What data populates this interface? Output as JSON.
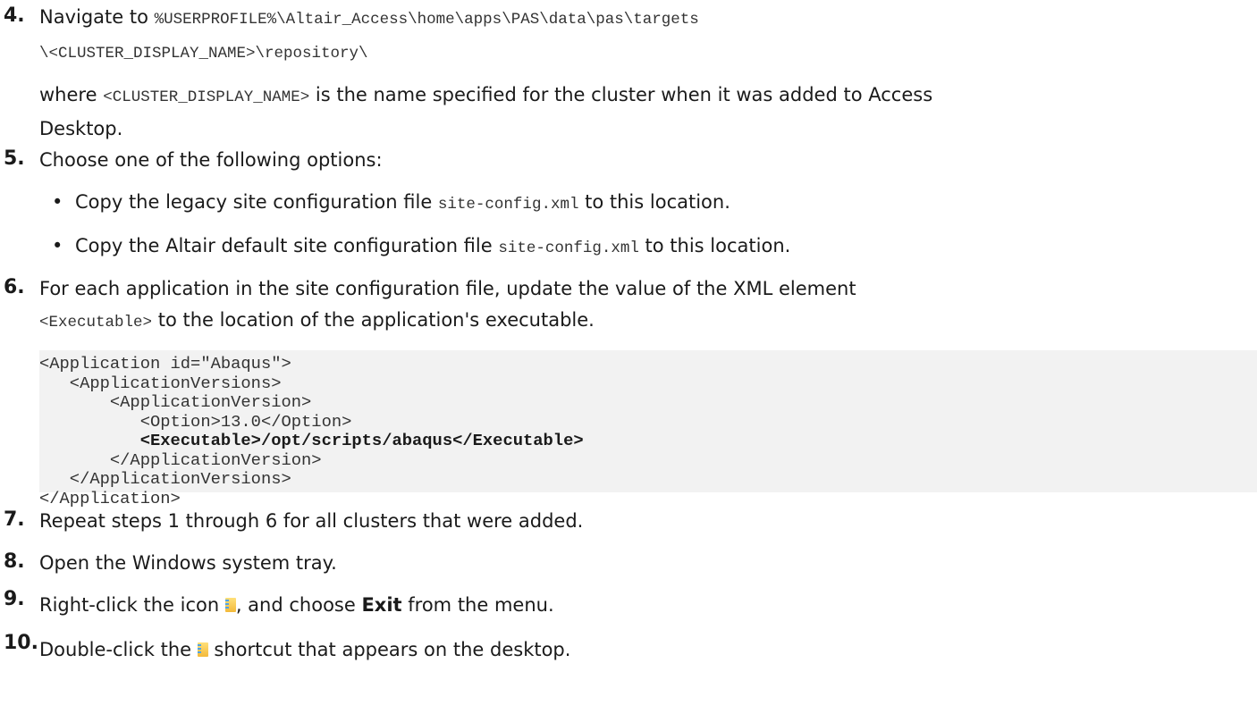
{
  "steps": {
    "s4": {
      "number": "4.",
      "lead": "Navigate to ",
      "path_line1": "%USERPROFILE%\\Altair_Access\\home\\apps\\PAS\\data\\pas\\targets",
      "path_line2": "\\<CLUSTER_DISPLAY_NAME>\\repository\\",
      "where_prefix": "where ",
      "where_code": "<CLUSTER_DISPLAY_NAME>",
      "where_rest_line1": " is the name specified for the cluster when it was added to Access",
      "where_rest_line2": "Desktop."
    },
    "s5": {
      "number": "5.",
      "text": "Choose one of the following options:",
      "bullets": [
        {
          "before": "Copy the legacy site configuration file ",
          "code": "site-config.xml",
          "after": " to this location."
        },
        {
          "before": "Copy the Altair default site configuration file ",
          "code": "site-config.xml",
          "after": " to this location."
        }
      ]
    },
    "s6": {
      "number": "6.",
      "line1": "For each application in the site configuration file, update the value of the XML element",
      "code": "<Executable>",
      "line2_rest": " to the location of the application's executable.",
      "code_block": [
        "<Application id=\"Abaqus\">",
        "   <ApplicationVersions>",
        "       <ApplicationVersion>",
        "          <Option>13.0</Option>",
        "          <Executable>/opt/scripts/abaqus</Executable>",
        "       </ApplicationVersion>",
        "   </ApplicationVersions>",
        "</Application>"
      ]
    },
    "s7": {
      "number": "7.",
      "text": "Repeat steps 1 through 6 for all clusters that were added."
    },
    "s8": {
      "number": "8.",
      "text": "Open the Windows system tray."
    },
    "s9": {
      "number": "9.",
      "before": "Right-click the icon ",
      "after": ", and choose ",
      "bold": "Exit",
      "end": " from the menu."
    },
    "s10": {
      "number": "10.",
      "before": "Double-click the ",
      "after": " shortcut that appears on the desktop."
    }
  },
  "icons": {
    "app_icon": "access-desktop-icon"
  }
}
